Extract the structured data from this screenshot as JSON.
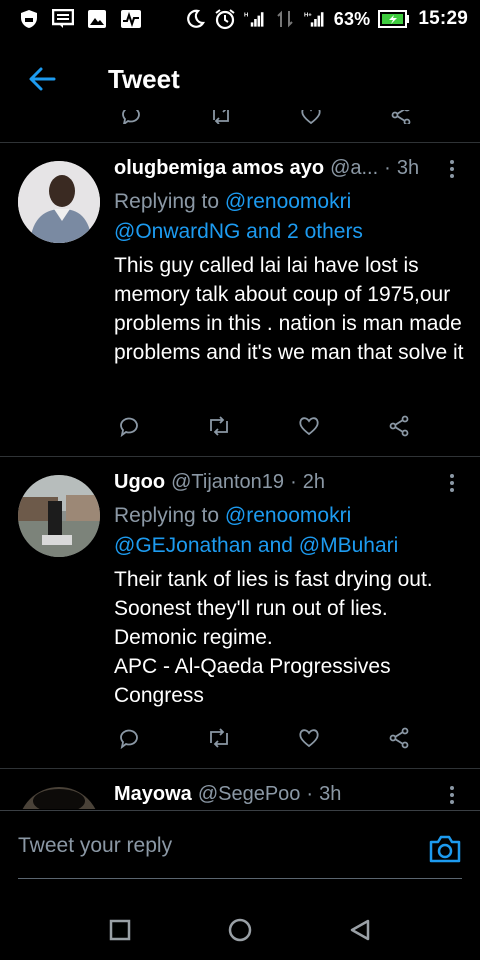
{
  "status_bar": {
    "battery_percent": "63%",
    "time": "15:29"
  },
  "header": {
    "title": "Tweet",
    "back_icon": "arrow-left-icon"
  },
  "tweets": [
    {
      "name": "olugbemiga amos ayo",
      "handle": "@a...",
      "time": "3h",
      "replying_label": "Replying to",
      "replying_to_line1": "@renoomokri",
      "replying_to_line2": "@OnwardNG and 2 others",
      "text": "This guy called lai lai have lost is memory talk about coup of 1975,our problems in this . nation is man made problems and it's we man that solve it"
    },
    {
      "name": "Ugoo",
      "handle": "@Tijanton19",
      "time": "2h",
      "replying_label": "Replying to",
      "replying_to_line1": "@renoomokri",
      "replying_to_line2": "@GEJonathan and @MBuhari",
      "text_lines": [
        "Their tank of lies is fast drying out.",
        "Soonest they'll run out of lies.",
        "Demonic regime.",
        "APC - Al-Qaeda Progressives",
        "Congress"
      ]
    },
    {
      "name": "Mayowa",
      "handle": "@SegePoo",
      "time": "3h"
    }
  ],
  "reply_bar": {
    "placeholder": "Tweet your reply"
  },
  "colors": {
    "background": "#000000",
    "accent": "#1d9bf0",
    "muted": "#8b98a5",
    "divider": "#2f3336"
  }
}
